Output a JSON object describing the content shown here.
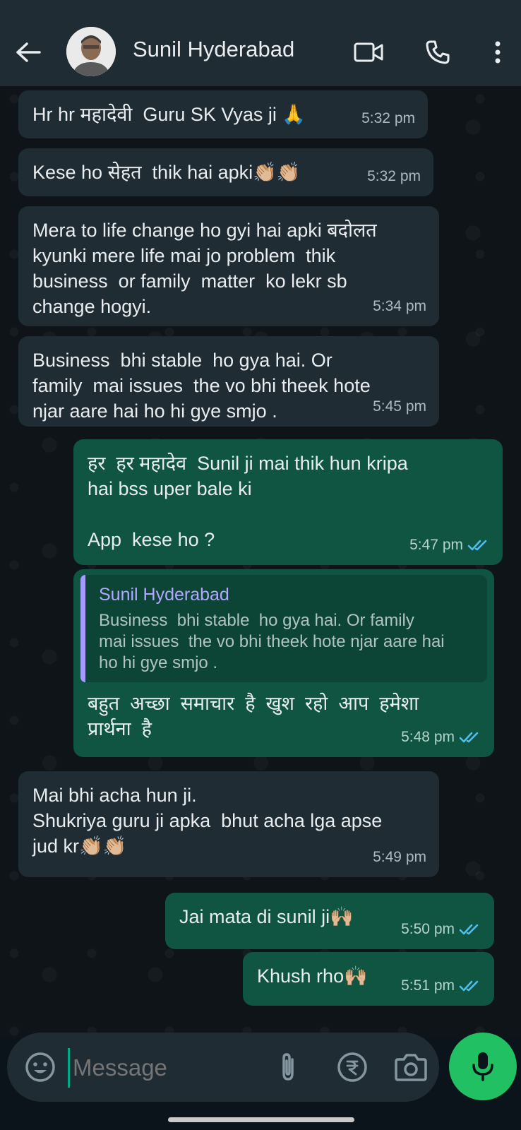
{
  "header": {
    "back_icon": "arrow-left-icon",
    "contact_name": "Sunil Hyderabad",
    "video_icon": "video-camera-icon",
    "call_icon": "phone-icon",
    "more_icon": "more-vertical-icon"
  },
  "messages": [
    {
      "direction": "in",
      "text": "Hr hr महादेवी  Guru SK Vyas ji 🙏",
      "time": "5:32 pm"
    },
    {
      "direction": "in",
      "text": "Kese ho सेहत  thik hai apki👏🏼👏🏼",
      "time": "5:32 pm"
    },
    {
      "direction": "in",
      "text": "Mera to life change ho gyi hai apki बदोलत\nkyunki mere life mai jo problem  thik\nbusiness  or family  matter  ko lekr sb\nchange hogyi.",
      "time": "5:34 pm"
    },
    {
      "direction": "in",
      "text": "Business  bhi stable  ho gya hai. Or\nfamily  mai issues  the vo bhi theek hote\nnjar aare hai ho hi gye smjo .",
      "time": "5:45 pm"
    },
    {
      "direction": "out",
      "text": "हर  हर महादेव  Sunil ji mai thik hun kripa\nhai bss uper bale ki\n\nApp  kese ho ?",
      "time": "5:47 pm",
      "status": "read"
    },
    {
      "direction": "out",
      "quote": {
        "name": "Sunil Hyderabad",
        "text": "Business  bhi stable  ho gya hai. Or family\nmai issues  the vo bhi theek hote njar aare hai\nho hi gye smjo ."
      },
      "text": "बहुत  अच्छा  समाचार  है  खुश  रहो  आप  हमेशा\nप्रार्थना  है",
      "time": "5:48 pm",
      "status": "read"
    },
    {
      "direction": "in",
      "text": "Mai bhi acha hun ji.\nShukriya guru ji apka  bhut acha lga apse\njud kr👏🏼👏🏼",
      "time": "5:49 pm"
    },
    {
      "direction": "out",
      "text": "Jai mata di sunil ji🙌🏼",
      "time": "5:50 pm",
      "status": "read"
    },
    {
      "direction": "out",
      "text": "Khush rho🙌🏼",
      "time": "5:51 pm",
      "status": "read"
    }
  ],
  "composer": {
    "placeholder": "Message",
    "emoji_icon": "emoji-icon",
    "attach_icon": "paperclip-icon",
    "payment_icon": "rupee-icon",
    "camera_icon": "camera-icon",
    "mic_icon": "microphone-icon"
  },
  "colors": {
    "header_bg": "#1f2c34",
    "incoming_bubble": "#1f2c34",
    "outgoing_bubble": "#0f5541",
    "accent": "#21c063",
    "read_ticks": "#53bdeb"
  }
}
